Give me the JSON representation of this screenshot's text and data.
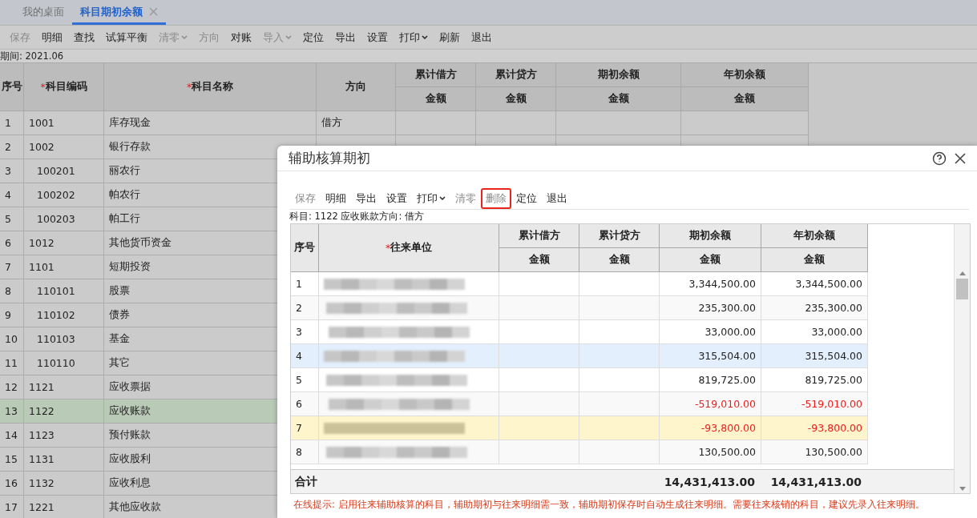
{
  "tabs": [
    {
      "label": "我的桌面",
      "selected": false,
      "closable": false
    },
    {
      "label": "科目期初余额",
      "selected": true,
      "closable": true
    }
  ],
  "toolbar": [
    {
      "label": "保存",
      "disabled": true,
      "dropdown": false
    },
    {
      "label": "明细",
      "disabled": false,
      "dropdown": false
    },
    {
      "label": "查找",
      "disabled": false,
      "dropdown": false
    },
    {
      "label": "试算平衡",
      "disabled": false,
      "dropdown": false
    },
    {
      "label": "清零",
      "disabled": true,
      "dropdown": true
    },
    {
      "label": "方向",
      "disabled": true,
      "dropdown": false
    },
    {
      "label": "对账",
      "disabled": false,
      "dropdown": false
    },
    {
      "label": "导入",
      "disabled": true,
      "dropdown": true
    },
    {
      "label": "定位",
      "disabled": false,
      "dropdown": false
    },
    {
      "label": "导出",
      "disabled": false,
      "dropdown": false
    },
    {
      "label": "设置",
      "disabled": false,
      "dropdown": false
    },
    {
      "label": "打印",
      "disabled": false,
      "dropdown": true
    },
    {
      "label": "刷新",
      "disabled": false,
      "dropdown": false
    },
    {
      "label": "退出",
      "disabled": false,
      "dropdown": false
    }
  ],
  "period": "期间: 2021.06",
  "main_table": {
    "columns": [
      {
        "label": "序号"
      },
      {
        "label": "科目编码",
        "required_mark": "*"
      },
      {
        "label": "科目名称",
        "required_mark": "*"
      },
      {
        "label": "方向"
      },
      {
        "label": "累计借方",
        "sub": "金额"
      },
      {
        "label": "累计贷方",
        "sub": "金额"
      },
      {
        "label": "期初余额",
        "sub": "金额"
      },
      {
        "label": "年初余额",
        "sub": "金额"
      }
    ],
    "rows": [
      {
        "no": "1",
        "code": "1001",
        "name": "库存现金",
        "direction": "借方",
        "selected": false
      },
      {
        "no": "2",
        "code": "1002",
        "name": "银行存款",
        "selected": false,
        "children": [
          {
            "no": "3",
            "code": "100201",
            "name": "丽农行",
            "selected": false
          },
          {
            "no": "4",
            "code": "100202",
            "name": "帕农行",
            "selected": false
          },
          {
            "no": "5",
            "code": "100203",
            "name": "帕工行",
            "selected": false
          }
        ]
      },
      {
        "no": "6",
        "code": "1012",
        "name": "其他货币资金",
        "selected": false
      },
      {
        "no": "7",
        "code": "1101",
        "name": "短期投资",
        "selected": false,
        "children": [
          {
            "no": "8",
            "code": "110101",
            "name": "股票",
            "selected": false
          },
          {
            "no": "9",
            "code": "110102",
            "name": "债券",
            "selected": false
          },
          {
            "no": "10",
            "code": "110103",
            "name": "基金",
            "selected": false
          },
          {
            "no": "11",
            "code": "110110",
            "name": "其它",
            "selected": false
          }
        ]
      },
      {
        "no": "12",
        "code": "1121",
        "name": "应收票据",
        "selected": false
      },
      {
        "no": "13",
        "code": "1122",
        "name": "应收账款",
        "selected": true
      },
      {
        "no": "14",
        "code": "1123",
        "name": "预付账款",
        "selected": false
      },
      {
        "no": "15",
        "code": "1131",
        "name": "应收股利",
        "selected": false
      },
      {
        "no": "16",
        "code": "1132",
        "name": "应收利息",
        "selected": false
      },
      {
        "no": "17",
        "code": "1221",
        "name": "其他应收款",
        "selected": false
      }
    ]
  },
  "dialog": {
    "title": "辅助核算期初",
    "toolbar": [
      {
        "label": "保存",
        "disabled": true,
        "dropdown": false,
        "annotated": false
      },
      {
        "label": "明细",
        "disabled": false,
        "dropdown": false,
        "annotated": false
      },
      {
        "label": "导出",
        "disabled": false,
        "dropdown": false,
        "annotated": false
      },
      {
        "label": "设置",
        "disabled": false,
        "dropdown": false,
        "annotated": false
      },
      {
        "label": "打印",
        "disabled": false,
        "dropdown": true,
        "annotated": false
      },
      {
        "label": "清零",
        "disabled": true,
        "dropdown": false,
        "annotated": false
      },
      {
        "label": "删除",
        "disabled": true,
        "dropdown": false,
        "annotated": true
      },
      {
        "label": "定位",
        "disabled": false,
        "dropdown": false,
        "annotated": false
      },
      {
        "label": "退出",
        "disabled": false,
        "dropdown": false,
        "annotated": false
      }
    ],
    "subject": "科目: 1122 应收账款方向: 借方",
    "columns": [
      {
        "label": "序号"
      },
      {
        "label": "往来单位",
        "required_mark": "*"
      },
      {
        "label": "累计借方",
        "sub": "金额"
      },
      {
        "label": "累计贷方",
        "sub": "金额"
      },
      {
        "label": "期初余额",
        "sub": "金额"
      },
      {
        "label": "年初余额",
        "sub": "金额"
      }
    ],
    "rows": [
      {
        "no": "1",
        "opening": "3,344,500.00",
        "year_start": "3,344,500.00",
        "negative": false,
        "selected": false,
        "marked": false
      },
      {
        "no": "2",
        "opening": "235,300.00",
        "year_start": "235,300.00",
        "negative": false,
        "selected": false,
        "marked": false
      },
      {
        "no": "3",
        "opening": "33,000.00",
        "year_start": "33,000.00",
        "negative": false,
        "selected": false,
        "marked": false
      },
      {
        "no": "4",
        "opening": "315,504.00",
        "year_start": "315,504.00",
        "negative": false,
        "selected": true,
        "marked": false
      },
      {
        "no": "5",
        "opening": "819,725.00",
        "year_start": "819,725.00",
        "negative": false,
        "selected": false,
        "marked": false
      },
      {
        "no": "6",
        "opening": "-519,010.00",
        "year_start": "-519,010.00",
        "negative": true,
        "selected": false,
        "marked": false
      },
      {
        "no": "7",
        "opening": "-93,800.00",
        "year_start": "-93,800.00",
        "negative": true,
        "selected": false,
        "marked": true
      },
      {
        "no": "8",
        "opening": "130,500.00",
        "year_start": "130,500.00",
        "negative": false,
        "selected": false,
        "marked": false
      }
    ],
    "total": {
      "label": "合计",
      "opening": "14,431,413.00",
      "year_start": "14,431,413.00"
    },
    "tip": "在线提示: 启用往来辅助核算的科目，辅助期初与往来明细需一致，辅助期初保存时自动生成往来明细。需要往来核销的科目，建议先录入往来明细。"
  }
}
